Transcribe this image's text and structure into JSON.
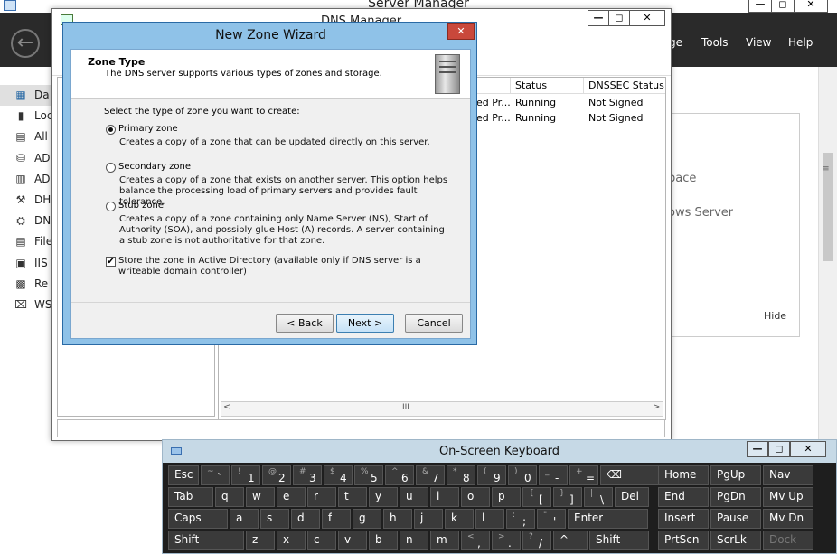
{
  "server_manager": {
    "title": "Server Manager",
    "caption_buttons": [
      "—",
      "◻",
      "✕"
    ],
    "menu": [
      "ge",
      "Tools",
      "View",
      "Help"
    ],
    "sidebar": [
      {
        "icon": "▦",
        "label": "Da"
      },
      {
        "icon": "▮",
        "label": "Loc"
      },
      {
        "icon": "▤",
        "label": "All"
      },
      {
        "icon": "⛁",
        "label": "AD"
      },
      {
        "icon": "▥",
        "label": "AD"
      },
      {
        "icon": "⚒",
        "label": "DH"
      },
      {
        "icon": "⛭",
        "label": "DN"
      },
      {
        "icon": "▤",
        "label": "File"
      },
      {
        "icon": "▣",
        "label": "IIS"
      },
      {
        "icon": "▩",
        "label": "Re"
      },
      {
        "icon": "⌧",
        "label": "WS"
      }
    ],
    "panel_text1": "pace",
    "panel_text2": "ows Server",
    "hide": "Hide"
  },
  "dns_manager": {
    "title": "DNS Manager",
    "caption_buttons": [
      "—",
      "◻",
      "✕"
    ],
    "columns": [
      "Status",
      "DNSSEC Status"
    ],
    "rows": [
      {
        "frag": "ed Pr...",
        "status": "Running",
        "dnssec": "Not Signed"
      },
      {
        "frag": "ed Pr...",
        "status": "Running",
        "dnssec": "Not Signed"
      }
    ],
    "scroll_mid": "III"
  },
  "wizard": {
    "title": "New Zone Wizard",
    "close": "✕",
    "heading": "Zone Type",
    "subheading": "The DNS server supports various types of zones and storage.",
    "prompt": "Select the type of zone you want to create:",
    "options": [
      {
        "label": "Primary zone",
        "desc": "Creates a copy of a zone that can be updated directly on this server.",
        "selected": true
      },
      {
        "label": "Secondary zone",
        "desc": "Creates a copy of a zone that exists on another server. This option helps balance the processing load of primary servers and provides fault tolerance.",
        "selected": false
      },
      {
        "label": "Stub zone",
        "desc": "Creates a copy of a zone containing only Name Server (NS), Start of Authority (SOA), and possibly glue Host (A) records. A server containing a stub zone is not authoritative for that zone.",
        "selected": false
      }
    ],
    "store_ad": "Store the zone in Active Directory (available only if DNS server is a writeable domain controller)",
    "store_ad_checked": true,
    "back": "< Back",
    "next": "Next >",
    "cancel": "Cancel"
  },
  "osk": {
    "title": "On-Screen Keyboard",
    "caption_buttons": [
      "—",
      "◻",
      "✕"
    ],
    "row1": [
      {
        "k": "Esc"
      },
      {
        "s": "~",
        "m": "`"
      },
      {
        "s": "!",
        "m": "1"
      },
      {
        "s": "@",
        "m": "2"
      },
      {
        "s": "#",
        "m": "3"
      },
      {
        "s": "$",
        "m": "4"
      },
      {
        "s": "%",
        "m": "5"
      },
      {
        "s": "^",
        "m": "6"
      },
      {
        "s": "&",
        "m": "7"
      },
      {
        "s": "*",
        "m": "8"
      },
      {
        "s": "(",
        "m": "9"
      },
      {
        "s": ")",
        "m": "0"
      },
      {
        "s": "_",
        "m": "-"
      },
      {
        "s": "+",
        "m": "="
      },
      {
        "k": "⌫"
      },
      {
        "k": "Home"
      },
      {
        "k": "PgUp"
      },
      {
        "k": "Nav"
      }
    ],
    "row2": [
      {
        "k": "Tab"
      },
      {
        "k": "q"
      },
      {
        "k": "w"
      },
      {
        "k": "e"
      },
      {
        "k": "r"
      },
      {
        "k": "t"
      },
      {
        "k": "y"
      },
      {
        "k": "u"
      },
      {
        "k": "i"
      },
      {
        "k": "o"
      },
      {
        "k": "p"
      },
      {
        "s": "{",
        "m": "["
      },
      {
        "s": "}",
        "m": "]"
      },
      {
        "s": "|",
        "m": "\\"
      },
      {
        "k": "Del"
      },
      {
        "k": "End"
      },
      {
        "k": "PgDn"
      },
      {
        "k": "Mv Up"
      }
    ],
    "row3": [
      {
        "k": "Caps"
      },
      {
        "k": "a"
      },
      {
        "k": "s"
      },
      {
        "k": "d"
      },
      {
        "k": "f"
      },
      {
        "k": "g"
      },
      {
        "k": "h"
      },
      {
        "k": "j"
      },
      {
        "k": "k"
      },
      {
        "k": "l"
      },
      {
        "s": ":",
        "m": ";"
      },
      {
        "s": "\"",
        "m": "'"
      },
      {
        "k": "Enter"
      },
      {
        "k": "Insert"
      },
      {
        "k": "Pause"
      },
      {
        "k": "Mv Dn"
      }
    ],
    "row4": [
      {
        "k": "Shift"
      },
      {
        "k": "z"
      },
      {
        "k": "x"
      },
      {
        "k": "c"
      },
      {
        "k": "v"
      },
      {
        "k": "b"
      },
      {
        "k": "n"
      },
      {
        "k": "m"
      },
      {
        "s": "<",
        "m": ","
      },
      {
        "s": ">",
        "m": "."
      },
      {
        "s": "?",
        "m": "/"
      },
      {
        "k": "^"
      },
      {
        "k": "Shift"
      },
      {
        "k": "PrtScn"
      },
      {
        "k": "ScrLk"
      },
      {
        "k": "Dock"
      }
    ]
  }
}
